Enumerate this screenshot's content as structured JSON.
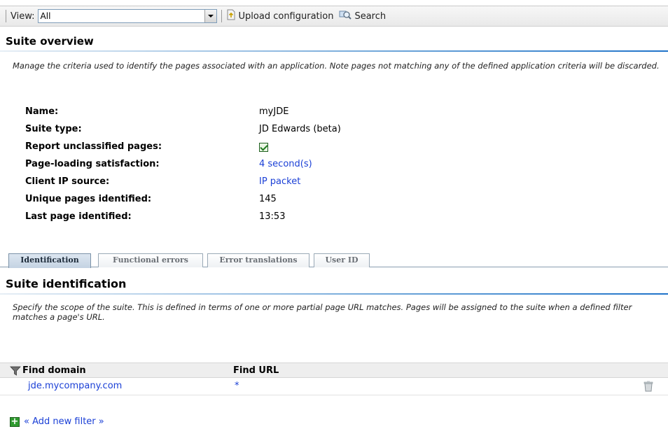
{
  "toolbar": {
    "view_label": "View:",
    "view_value": "All",
    "upload_label": "Upload configuration",
    "search_label": "Search"
  },
  "overview": {
    "title": "Suite overview",
    "description": "Manage the criteria used to identify the pages associated with an application. Note pages not matching any of the defined application criteria will be discarded.",
    "fields": [
      {
        "label": "Name:",
        "value": "myJDE"
      },
      {
        "label": "Suite type:",
        "value": "JD Edwards (beta)"
      },
      {
        "label": "Report unclassified pages:",
        "value": ""
      },
      {
        "label": "Page-loading satisfaction:",
        "value": "4 second(s)"
      },
      {
        "label": "Client IP source:",
        "value": "IP packet"
      },
      {
        "label": "Unique pages identified:",
        "value": "145"
      },
      {
        "label": "Last page identified:",
        "value": "13:53"
      }
    ],
    "report_unclassified_checked": true
  },
  "tabs": [
    {
      "label": "Identification",
      "active": true
    },
    {
      "label": "Functional errors",
      "active": false
    },
    {
      "label": "Error translations",
      "active": false
    },
    {
      "label": "User ID",
      "active": false
    }
  ],
  "identification": {
    "title": "Suite identification",
    "description": "Specify the scope of the suite. This is defined in terms of one or more partial page URL matches. Pages will be assigned to the suite when a defined filter matches a page's URL.",
    "columns": [
      "Find domain",
      "Find URL"
    ],
    "rows": [
      {
        "domain": "jde.mycompany.com",
        "url": "*"
      }
    ],
    "add_filter_label": "« Add new filter »"
  },
  "colors": {
    "accent_line": "#1f73c9",
    "link": "#1a3fd6",
    "tab_active_bg": "#c4d3e2",
    "table_header_bg": "#eeeeee"
  }
}
